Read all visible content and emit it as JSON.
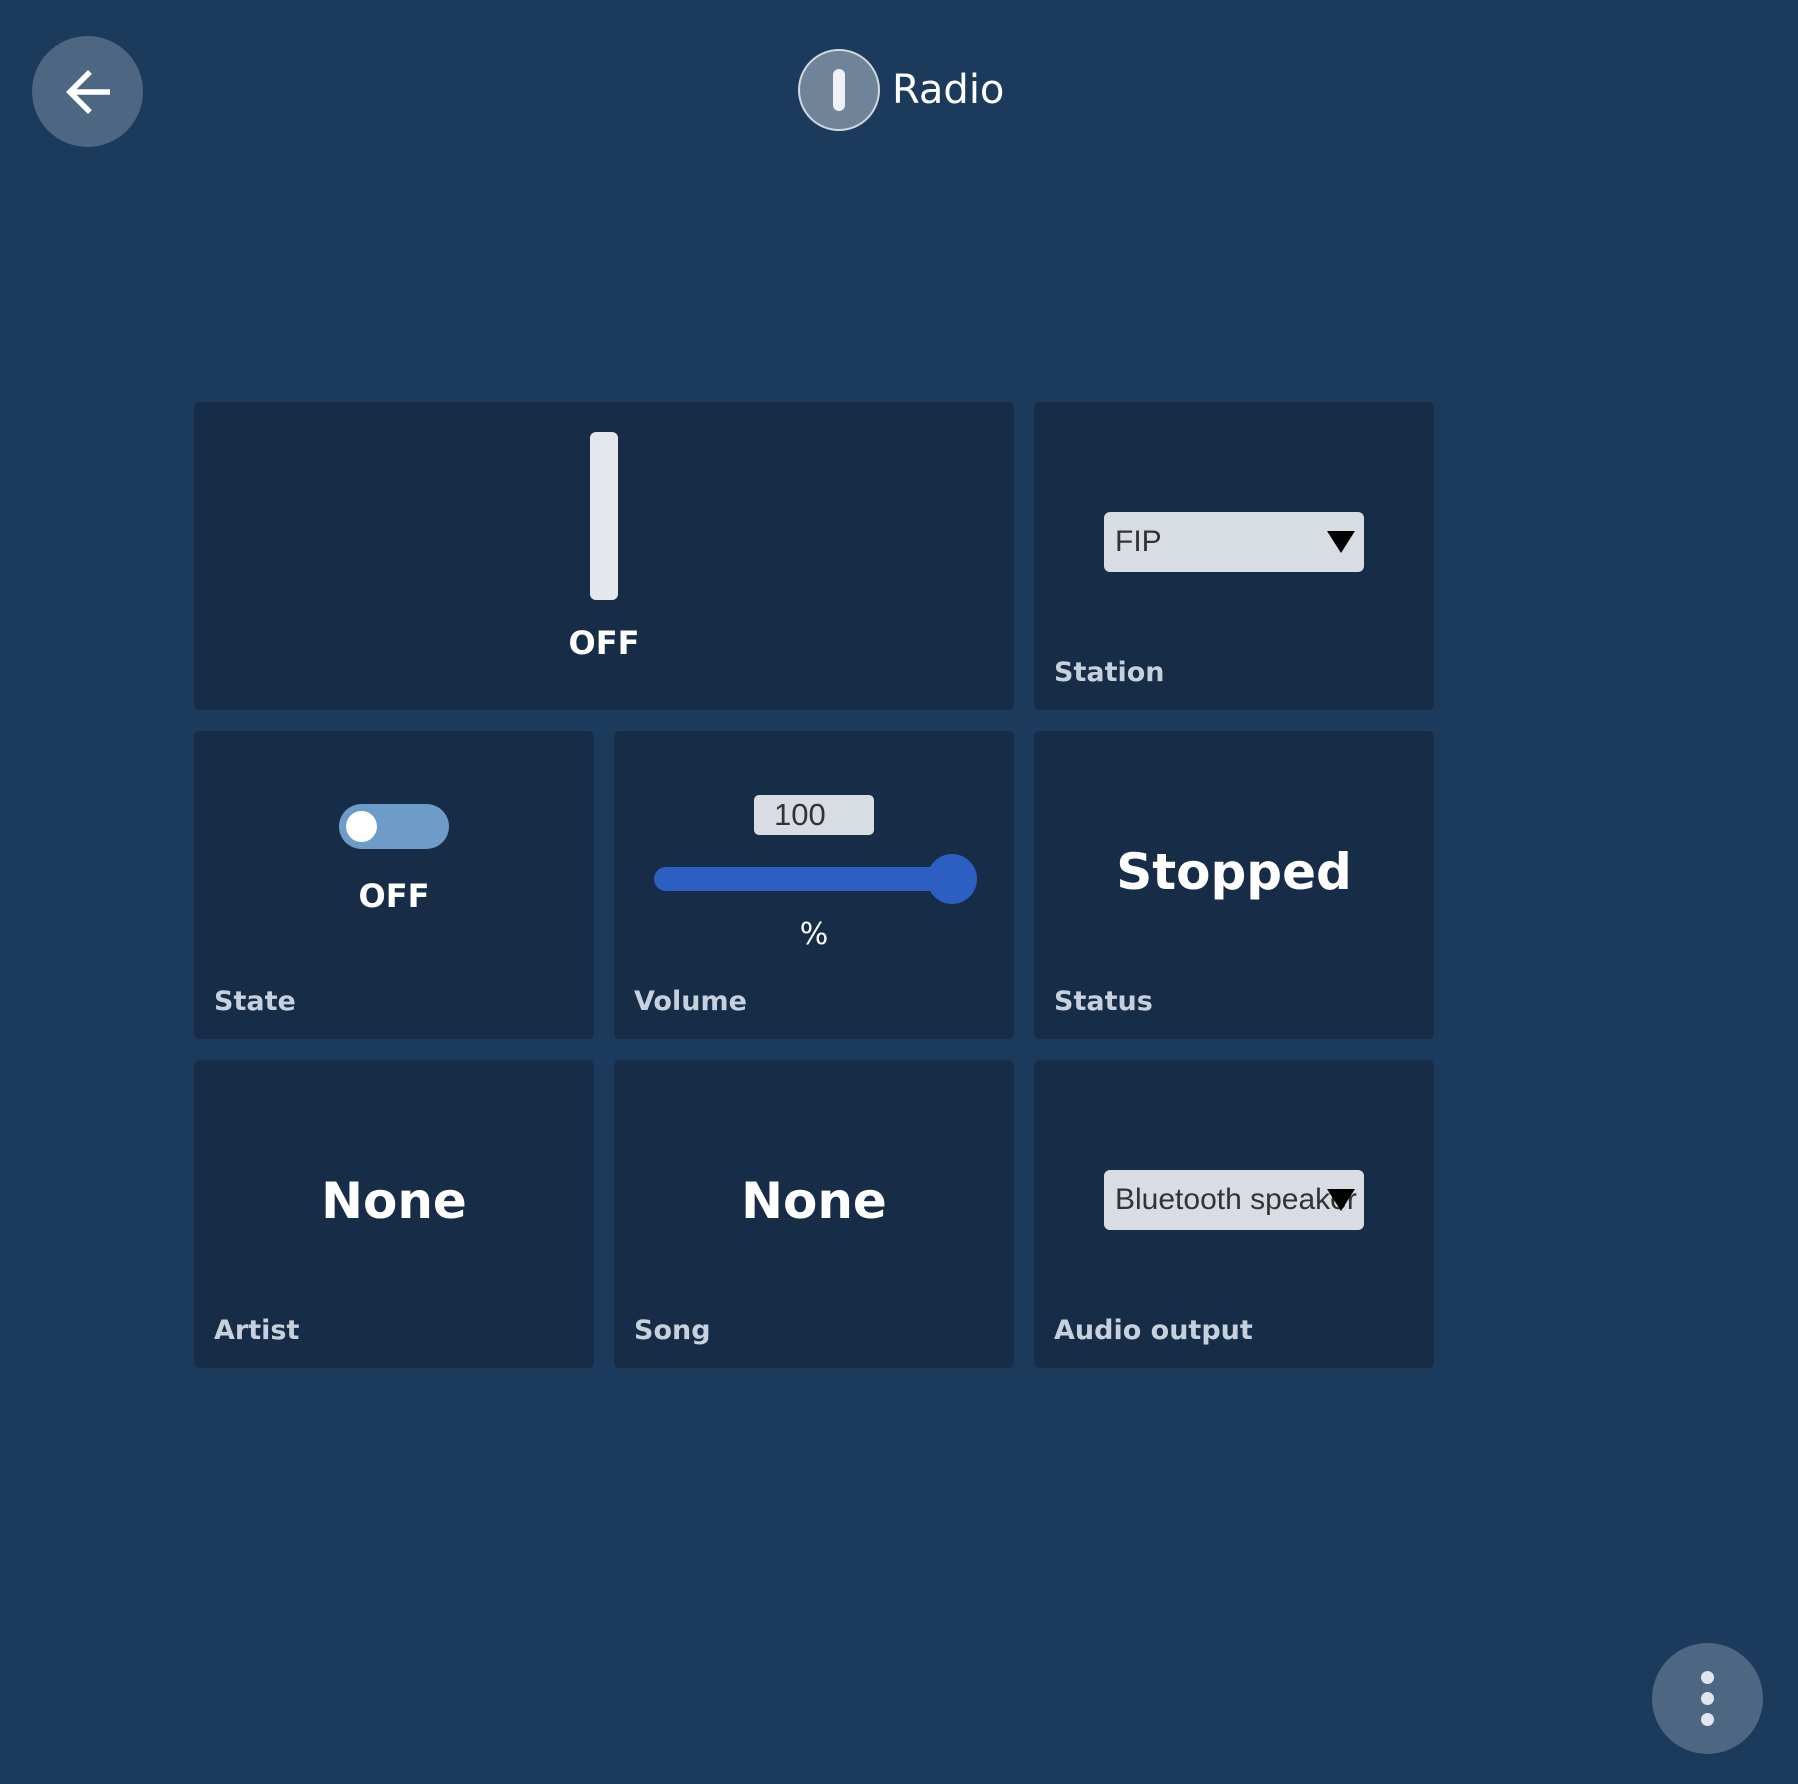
{
  "header": {
    "title": "Radio",
    "back_icon": "arrow-left-icon",
    "title_icon": "switch-icon"
  },
  "tiles": {
    "main_switch": {
      "state_text": "OFF"
    },
    "station": {
      "selected": "FIP",
      "label": "Station"
    },
    "state": {
      "state_text": "OFF",
      "label": "State",
      "toggle_on": false
    },
    "volume": {
      "value": "100",
      "unit": "%",
      "label": "Volume",
      "level_percent": 100
    },
    "status": {
      "value": "Stopped",
      "label": "Status"
    },
    "artist": {
      "value": "None",
      "label": "Artist"
    },
    "song": {
      "value": "None",
      "label": "Song"
    },
    "audio_output": {
      "selected": "Bluetooth speaker",
      "label": "Audio output"
    }
  },
  "fab": {
    "icon": "more-vertical-icon"
  },
  "colors": {
    "background": "#1c3a5b",
    "tile": "#162c47",
    "accent": "#2d5fc2",
    "toggle_track": "#6e9cc9",
    "round_button": "#4d6782"
  }
}
